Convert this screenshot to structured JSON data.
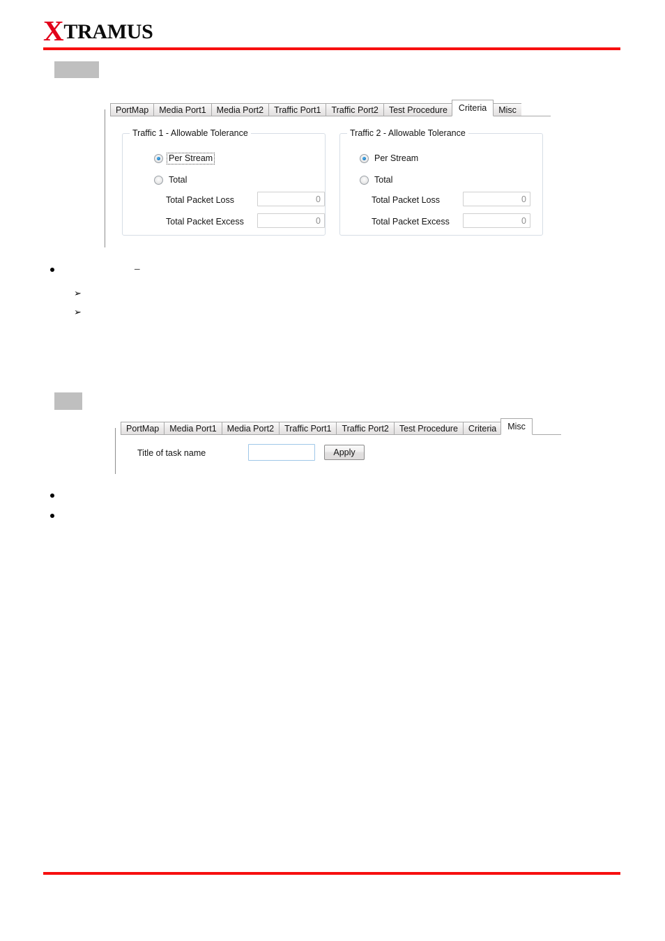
{
  "header": {
    "logo_x": "X",
    "logo_rest": "TRAMUS",
    "rule_color": "#f70f0f"
  },
  "panels": [
    {
      "name": "criteria-panel",
      "tabs": [
        {
          "label": "PortMap",
          "active": false
        },
        {
          "label": "Media Port1",
          "active": false
        },
        {
          "label": "Media Port2",
          "active": false
        },
        {
          "label": "Traffic Port1",
          "active": false
        },
        {
          "label": "Traffic Port2",
          "active": false
        },
        {
          "label": "Test Procedure",
          "active": false
        },
        {
          "label": "Criteria",
          "active": true
        },
        {
          "label": "Misc",
          "active": false
        }
      ],
      "groups": [
        {
          "title": "Traffic 1 - Allowable Tolerance",
          "radios": [
            {
              "label": "Per Stream",
              "checked": true,
              "focused": true
            },
            {
              "label": "Total",
              "checked": false,
              "focused": false
            }
          ],
          "fields": [
            {
              "label": "Total Packet Loss",
              "value": "0",
              "enabled": false
            },
            {
              "label": "Total Packet Excess",
              "value": "0",
              "enabled": false
            }
          ]
        },
        {
          "title": "Traffic 2 - Allowable Tolerance",
          "radios": [
            {
              "label": "Per Stream",
              "checked": true,
              "focused": false
            },
            {
              "label": "Total",
              "checked": false,
              "focused": false
            }
          ],
          "fields": [
            {
              "label": "Total Packet Loss",
              "value": "0",
              "enabled": false
            },
            {
              "label": "Total Packet Excess",
              "value": "0",
              "enabled": false
            }
          ]
        }
      ]
    },
    {
      "name": "misc-panel",
      "tabs": [
        {
          "label": "PortMap",
          "active": false
        },
        {
          "label": "Media Port1",
          "active": false
        },
        {
          "label": "Media Port2",
          "active": false
        },
        {
          "label": "Traffic Port1",
          "active": false
        },
        {
          "label": "Traffic Port2",
          "active": false
        },
        {
          "label": "Test Procedure",
          "active": false
        },
        {
          "label": "Criteria",
          "active": false
        },
        {
          "label": "Misc",
          "active": true
        }
      ],
      "form": {
        "label": "Title of task name",
        "value": "",
        "placeholder": "",
        "apply_label": "Apply"
      }
    }
  ],
  "bullets": {
    "dash": "–",
    "arrow": "➢"
  }
}
